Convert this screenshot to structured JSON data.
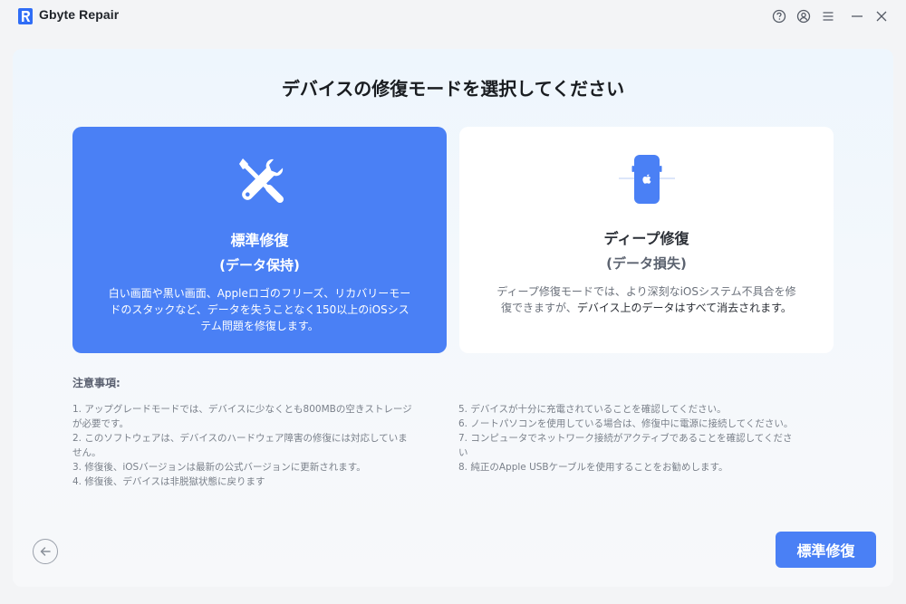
{
  "app": {
    "title": "Gbyte Repair",
    "accent_color": "#4a80f5"
  },
  "titlebar": {
    "icons": [
      "help-icon",
      "account-icon",
      "menu-icon",
      "minimize-icon",
      "close-icon"
    ]
  },
  "page": {
    "title": "デバイスの修復モードを選択してください"
  },
  "modes": {
    "standard": {
      "icon": "wrench-screwdriver-icon",
      "title": "標準修復",
      "subtitle": "(データ保持)",
      "description_lines": [
        "白い画面や黒い画面、Appleロゴのフリーズ、リカバリーモー",
        "ドのスタックなど、データを失うことなく150以上のiOSシス",
        "テム問題を修復します。"
      ]
    },
    "deep": {
      "icon": "phone-apple-icon",
      "title": "ディープ修復",
      "subtitle": "(データ損失)",
      "description_line1": "ディープ修復モードでは、より深刻なiOSシステム不具合を修",
      "description_line2_plain": "復できますが、",
      "description_line2_bold": "デバイス上のデータはすべて消去されます。"
    }
  },
  "notes": {
    "heading": "注意事項:",
    "left": [
      "1. アップグレードモードでは、デバイスに少なくとも800MBの空きストレージ",
      "が必要です。",
      "2. このソフトウェアは、デバイスのハードウェア障害の修復には対応していま",
      "せん。",
      "3. 修復後、iOSバージョンは最新の公式バージョンに更新されます。",
      "4. 修復後、デバイスは非脱獄状態に戻ります"
    ],
    "right": [
      "5. デバイスが十分に充電されていることを確認してください。",
      "6. ノートパソコンを使用している場合は、修復中に電源に接続してください。",
      "7. コンピュータでネットワーク接続がアクティブであることを確認してくださ",
      "い",
      "8. 純正のApple USBケーブルを使用することをお勧めします。"
    ]
  },
  "actions": {
    "back_icon": "arrow-left-icon",
    "primary_label": "標準修復"
  }
}
